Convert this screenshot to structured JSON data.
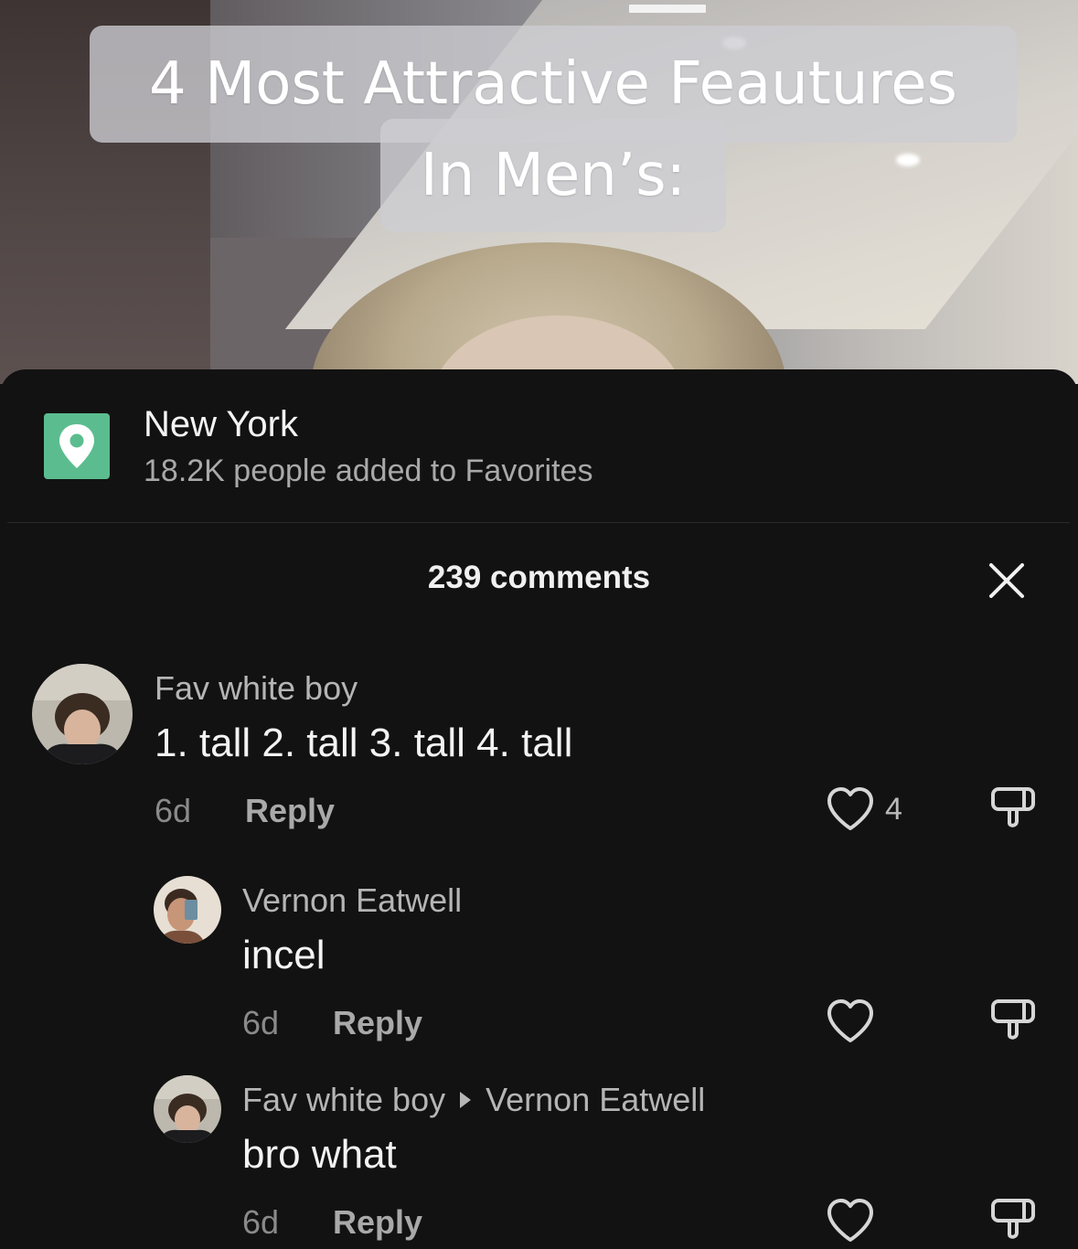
{
  "video": {
    "caption_line1": "4 Most Attractive Feautures",
    "caption_line2": "In Men’s:"
  },
  "location": {
    "icon": "location-pin-icon",
    "title": "New York",
    "subtitle": "18.2K people added to Favorites",
    "accent": "#5bbd8f"
  },
  "comments_header": {
    "title": "239 comments",
    "close_icon": "close-icon"
  },
  "comments": [
    {
      "author": "Fav white boy",
      "text": "1. tall 2. tall 3. tall 4. tall",
      "time": "6d",
      "reply_label": "Reply",
      "likes": "4"
    },
    {
      "author": "Vernon Eatwell",
      "text": "incel",
      "time": "6d",
      "reply_label": "Reply",
      "likes": ""
    },
    {
      "author": "Fav white boy",
      "reply_to": "Vernon Eatwell",
      "text": "bro what",
      "time": "6d",
      "reply_label": "Reply",
      "likes": ""
    }
  ]
}
